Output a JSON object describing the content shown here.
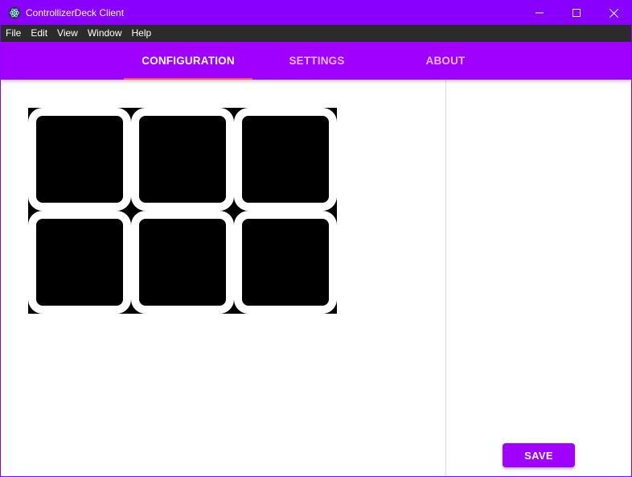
{
  "window": {
    "title": "ControllizerDeck Client",
    "icon": "electron-atom-icon",
    "controls": {
      "minimize_icon": "minimize-icon",
      "maximize_icon": "maximize-icon",
      "close_icon": "close-icon"
    }
  },
  "menu": {
    "items": [
      "File",
      "Edit",
      "View",
      "Window",
      "Help"
    ]
  },
  "tabs": {
    "items": [
      {
        "label": "CONFIGURATION",
        "active": true
      },
      {
        "label": "SETTINGS",
        "active": false
      },
      {
        "label": "ABOUT",
        "active": false
      }
    ]
  },
  "deck": {
    "rows": 2,
    "columns": 3,
    "buttons": [
      "",
      "",
      "",
      "",
      "",
      ""
    ]
  },
  "actions": {
    "save_label": "SAVE"
  },
  "colors": {
    "titlebar": "#8a00ff",
    "appbar": "#a000ff",
    "menubar": "#2b2b2b",
    "tab_indicator": "#ff5252",
    "save_button": "#a000ff"
  }
}
